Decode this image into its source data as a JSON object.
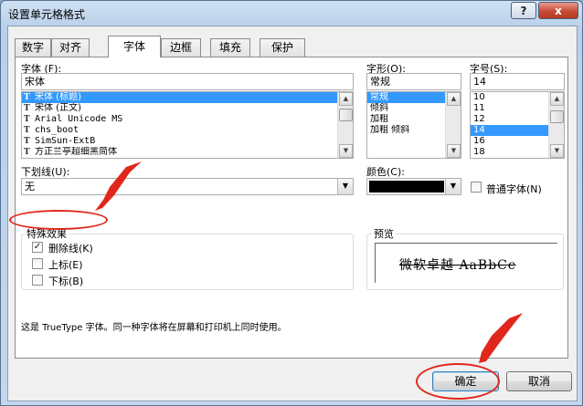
{
  "dialog": {
    "title": "设置单元格格式",
    "help_label": "?",
    "close_label": "x"
  },
  "tabs": [
    {
      "label": "数字"
    },
    {
      "label": "对齐"
    },
    {
      "label": "字体"
    },
    {
      "label": "边框"
    },
    {
      "label": "填充"
    },
    {
      "label": "保护"
    }
  ],
  "font": {
    "label": "字体 (F):",
    "value": "宋体",
    "items": [
      "宋体 (标题)",
      "宋体 (正文)",
      "Arial Unicode MS",
      "chs_boot",
      "SimSun-ExtB",
      "方正兰亭超细黑简体"
    ],
    "selected_index": 0
  },
  "style": {
    "label": "字形(O):",
    "value": "常规",
    "items": [
      "常规",
      "倾斜",
      "加粗",
      "加粗 倾斜"
    ],
    "selected_index": 0
  },
  "size": {
    "label": "字号(S):",
    "value": "14",
    "items": [
      "10",
      "11",
      "12",
      "14",
      "16",
      "18"
    ],
    "selected_index": 3
  },
  "underline": {
    "label": "下划线(U):",
    "value": "无"
  },
  "color": {
    "label": "颜色(C):",
    "swatch": "#000000"
  },
  "normal_font": {
    "label": "普通字体(N)",
    "checked": false
  },
  "effects": {
    "label": "特殊效果",
    "items": [
      {
        "label": "删除线(K)",
        "checked": true
      },
      {
        "label": "上标(E)",
        "checked": false
      },
      {
        "label": "下标(B)",
        "checked": false
      }
    ]
  },
  "preview": {
    "label": "预览",
    "text": "微软卓越  AaBbCc"
  },
  "info_text": "这是 TrueType 字体。同一种字体将在屏幕和打印机上同时使用。",
  "buttons": {
    "ok": "确定",
    "cancel": "取消"
  },
  "colors": {
    "accent_highlight": "#3399ff",
    "annotation_red": "#e0271c"
  }
}
